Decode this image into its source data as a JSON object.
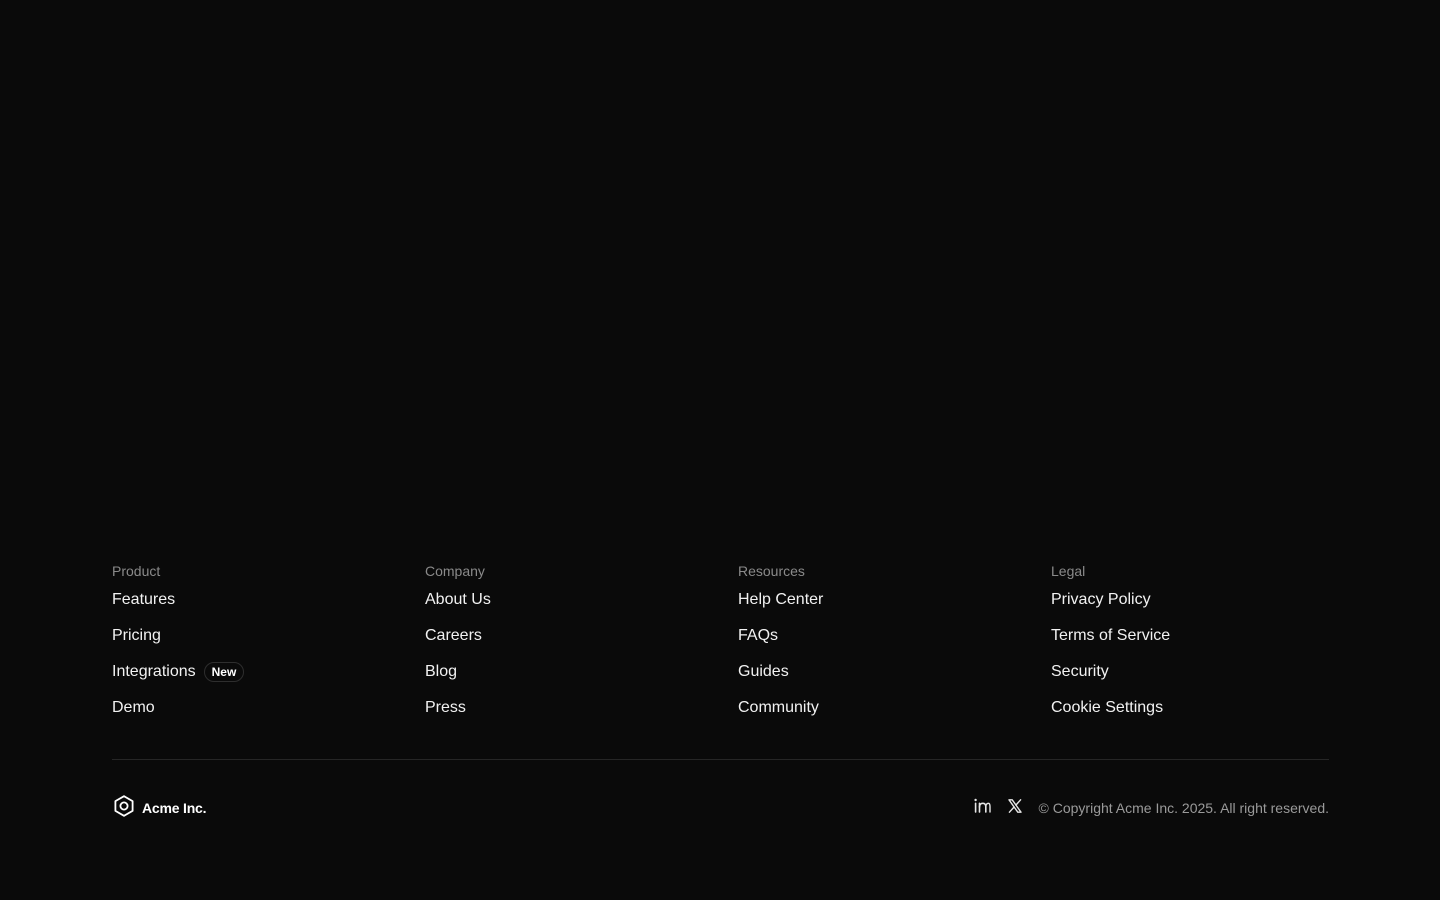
{
  "columns": [
    {
      "heading": "Product",
      "links": [
        {
          "label": "Features"
        },
        {
          "label": "Pricing"
        },
        {
          "label": "Integrations",
          "badge": "New"
        },
        {
          "label": "Demo"
        }
      ]
    },
    {
      "heading": "Company",
      "links": [
        {
          "label": "About Us"
        },
        {
          "label": "Careers"
        },
        {
          "label": "Blog"
        },
        {
          "label": "Press"
        }
      ]
    },
    {
      "heading": "Resources",
      "links": [
        {
          "label": "Help Center"
        },
        {
          "label": "FAQs"
        },
        {
          "label": "Guides"
        },
        {
          "label": "Community"
        }
      ]
    },
    {
      "heading": "Legal",
      "links": [
        {
          "label": "Privacy Policy"
        },
        {
          "label": "Terms of Service"
        },
        {
          "label": "Security"
        },
        {
          "label": "Cookie Settings"
        }
      ]
    }
  ],
  "brand": {
    "name": "Acme Inc.",
    "logo_icon": "hexagon-logo-icon"
  },
  "social": [
    {
      "icon": "linkedin-icon"
    },
    {
      "icon": "x-twitter-icon"
    }
  ],
  "copyright": "© Copyright Acme Inc. 2025. All right reserved.",
  "colors": {
    "background": "#0a0a0a",
    "heading": "#8a8a8a",
    "link": "#f2f2f2",
    "muted": "#9a9a9a",
    "divider": "#262626"
  }
}
